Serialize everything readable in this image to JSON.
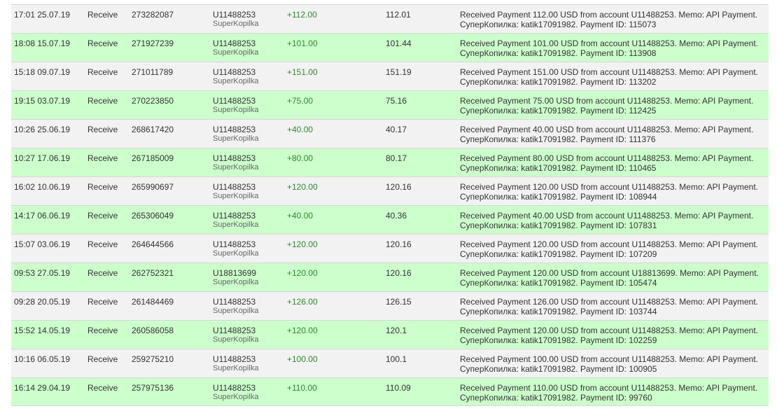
{
  "colors": {
    "row_odd": "#f2f2f2",
    "row_even": "#ccffcc",
    "amount": "#2e8b2e"
  },
  "rows": [
    {
      "time": "17:01 25.07.19",
      "type": "Receive",
      "batch": "273282087",
      "account": "U11488253",
      "account_name": "SuperKopilka",
      "amount": "+112.00",
      "total": "112.01",
      "memo1": "Received Payment 112.00 USD from account U11488253. Memo: API Payment.",
      "memo2": "СуперКопилка: katik17091982. Payment ID: 115073"
    },
    {
      "time": "18:08 15.07.19",
      "type": "Receive",
      "batch": "271927239",
      "account": "U11488253",
      "account_name": "SuperKopilka",
      "amount": "+101.00",
      "total": "101.44",
      "memo1": "Received Payment 101.00 USD from account U11488253. Memo: API Payment.",
      "memo2": "СуперКопилка: katik17091982. Payment ID: 113908"
    },
    {
      "time": "15:18 09.07.19",
      "type": "Receive",
      "batch": "271011789",
      "account": "U11488253",
      "account_name": "SuperKopilka",
      "amount": "+151.00",
      "total": "151.19",
      "memo1": "Received Payment 151.00 USD from account U11488253. Memo: API Payment.",
      "memo2": "СуперКопилка: katik17091982. Payment ID: 113202"
    },
    {
      "time": "19:15 03.07.19",
      "type": "Receive",
      "batch": "270223850",
      "account": "U11488253",
      "account_name": "SuperKopilka",
      "amount": "+75.00",
      "total": "75.16",
      "memo1": "Received Payment 75.00 USD from account U11488253. Memo: API Payment.",
      "memo2": "СуперКопилка: katik17091982. Payment ID: 112425"
    },
    {
      "time": "10:26 25.06.19",
      "type": "Receive",
      "batch": "268617420",
      "account": "U11488253",
      "account_name": "SuperKopilka",
      "amount": "+40.00",
      "total": "40.17",
      "memo1": "Received Payment 40.00 USD from account U11488253. Memo: API Payment.",
      "memo2": "СуперКопилка: katik17091982. Payment ID: 111376"
    },
    {
      "time": "10:27 17.06.19",
      "type": "Receive",
      "batch": "267185009",
      "account": "U11488253",
      "account_name": "SuperKopilka",
      "amount": "+80.00",
      "total": "80.17",
      "memo1": "Received Payment 80.00 USD from account U11488253. Memo: API Payment.",
      "memo2": "СуперКопилка: katik17091982. Payment ID: 110465"
    },
    {
      "time": "16:02 10.06.19",
      "type": "Receive",
      "batch": "265990697",
      "account": "U11488253",
      "account_name": "SuperKopilka",
      "amount": "+120.00",
      "total": "120.16",
      "memo1": "Received Payment 120.00 USD from account U11488253. Memo: API Payment.",
      "memo2": "СуперКопилка: katik17091982. Payment ID: 108944"
    },
    {
      "time": "14:17 06.06.19",
      "type": "Receive",
      "batch": "265306049",
      "account": "U11488253",
      "account_name": "SuperKopilka",
      "amount": "+40.00",
      "total": "40.36",
      "memo1": "Received Payment 40.00 USD from account U11488253. Memo: API Payment.",
      "memo2": "СуперКопилка: katik17091982. Payment ID: 107831"
    },
    {
      "time": "15:07 03.06.19",
      "type": "Receive",
      "batch": "264644566",
      "account": "U11488253",
      "account_name": "SuperKopilka",
      "amount": "+120.00",
      "total": "120.16",
      "memo1": "Received Payment 120.00 USD from account U11488253. Memo: API Payment.",
      "memo2": "СуперКопилка: katik17091982. Payment ID: 107209"
    },
    {
      "time": "09:53 27.05.19",
      "type": "Receive",
      "batch": "262752321",
      "account": "U18813699",
      "account_name": "SuperKopilka",
      "amount": "+120.00",
      "total": "120.16",
      "memo1": "Received Payment 120.00 USD from account U18813699. Memo: API Payment.",
      "memo2": "СуперКопилка: katik17091982. Payment ID: 105474"
    },
    {
      "time": "09:28 20.05.19",
      "type": "Receive",
      "batch": "261484469",
      "account": "U11488253",
      "account_name": "SuperKopilka",
      "amount": "+126.00",
      "total": "126.15",
      "memo1": "Received Payment 126.00 USD from account U11488253. Memo: API Payment.",
      "memo2": "СуперКопилка: katik17091982. Payment ID: 103744"
    },
    {
      "time": "15:52 14.05.19",
      "type": "Receive",
      "batch": "260586058",
      "account": "U11488253",
      "account_name": "SuperKopilka",
      "amount": "+120.00",
      "total": "120.1",
      "memo1": "Received Payment 120.00 USD from account U11488253. Memo: API Payment.",
      "memo2": "СуперКопилка: katik17091982. Payment ID: 102259"
    },
    {
      "time": "10:16 06.05.19",
      "type": "Receive",
      "batch": "259275210",
      "account": "U11488253",
      "account_name": "SuperKopilka",
      "amount": "+100.00",
      "total": "100.1",
      "memo1": "Received Payment 100.00 USD from account U11488253. Memo: API Payment.",
      "memo2": "СуперКопилка: katik17091982. Payment ID: 100905"
    },
    {
      "time": "16:14 29.04.19",
      "type": "Receive",
      "batch": "257975136",
      "account": "U11488253",
      "account_name": "SuperKopilka",
      "amount": "+110.00",
      "total": "110.09",
      "memo1": "Received Payment 110.00 USD from account U11488253. Memo: API Payment.",
      "memo2": "СуперКопилка: katik17091982. Payment ID: 99760"
    }
  ]
}
